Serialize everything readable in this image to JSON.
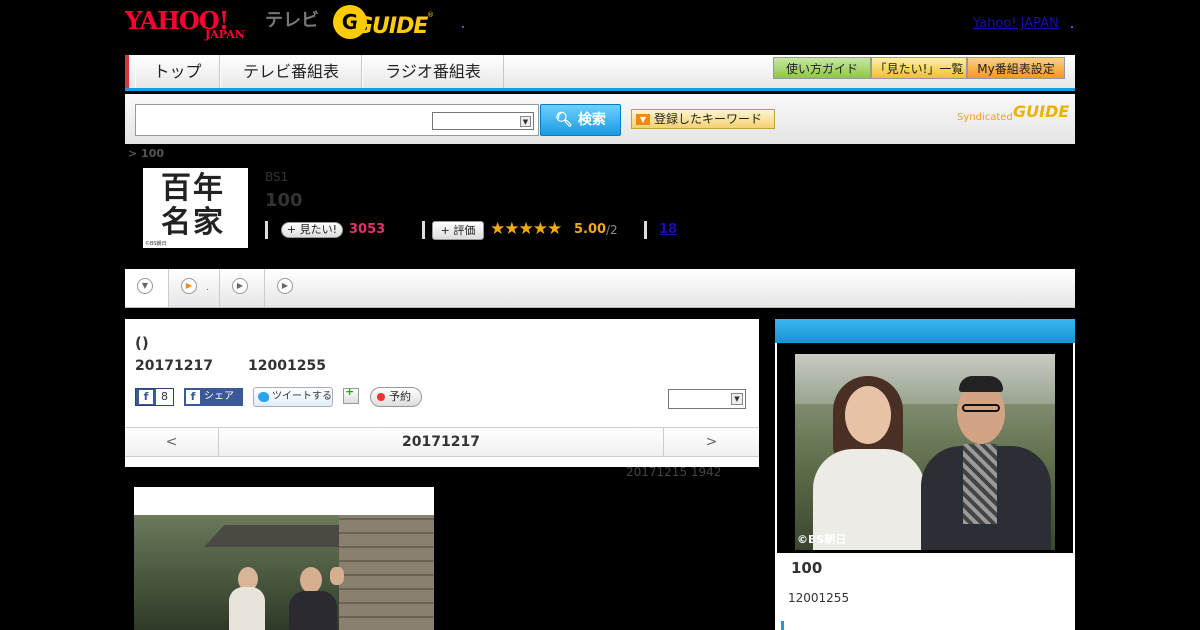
{
  "header": {
    "yahoo_logo_main": "YAHOO!",
    "yahoo_logo_sub": "JAPAN",
    "tv_label": "テレビ",
    "gguide_logo": "GUIDE",
    "gguide_reg": "®",
    "yahoo_japan_link": "Yahoo! JAPAN"
  },
  "nav": {
    "tabs": [
      "トップ",
      "テレビ番組表",
      "ラジオ番組表"
    ],
    "buttons": [
      "使い方ガイド",
      "「見たい!」一覧",
      "My番組表設定"
    ]
  },
  "search": {
    "input_value": "",
    "select_value": "",
    "button_label": "検索",
    "keyword_button": "登録したキーワード",
    "syndicated_label": "Syndicated",
    "syndicated_logo": "GUIDE"
  },
  "program": {
    "breadcrumb": "> 100",
    "thumb_mark": "百年名家",
    "thumb_copy": "©BS朝日",
    "channel": "BS1",
    "title": "100",
    "mitai_label": "見たい!",
    "mitai_count": "3053",
    "rate_label": "評価",
    "stars": "★★★★★",
    "rating_value": "5.00",
    "rating_count": "/2",
    "review_link": "18"
  },
  "episode": {
    "title": "()",
    "date": "20171217",
    "time": "12001255",
    "fb_count": "8",
    "fb_share": "シェア",
    "tweet": "ツイートする",
    "reserve": "予約",
    "share_select": "",
    "prev": "<",
    "current_date": "20171217",
    "next": ">",
    "updated_at": "20171215  1942"
  },
  "side": {
    "photo_credit": "©BS朝日",
    "title": "100",
    "time": "12001255"
  },
  "icons": {
    "search": "search-icon",
    "play": "play-icon",
    "down": "chevron-down-icon"
  },
  "colors": {
    "accent": "#1a9be0",
    "mitai": "#e0336a",
    "rating": "#f4a810",
    "yahoo": "#ff0033",
    "gguide": "#ffcc00"
  }
}
